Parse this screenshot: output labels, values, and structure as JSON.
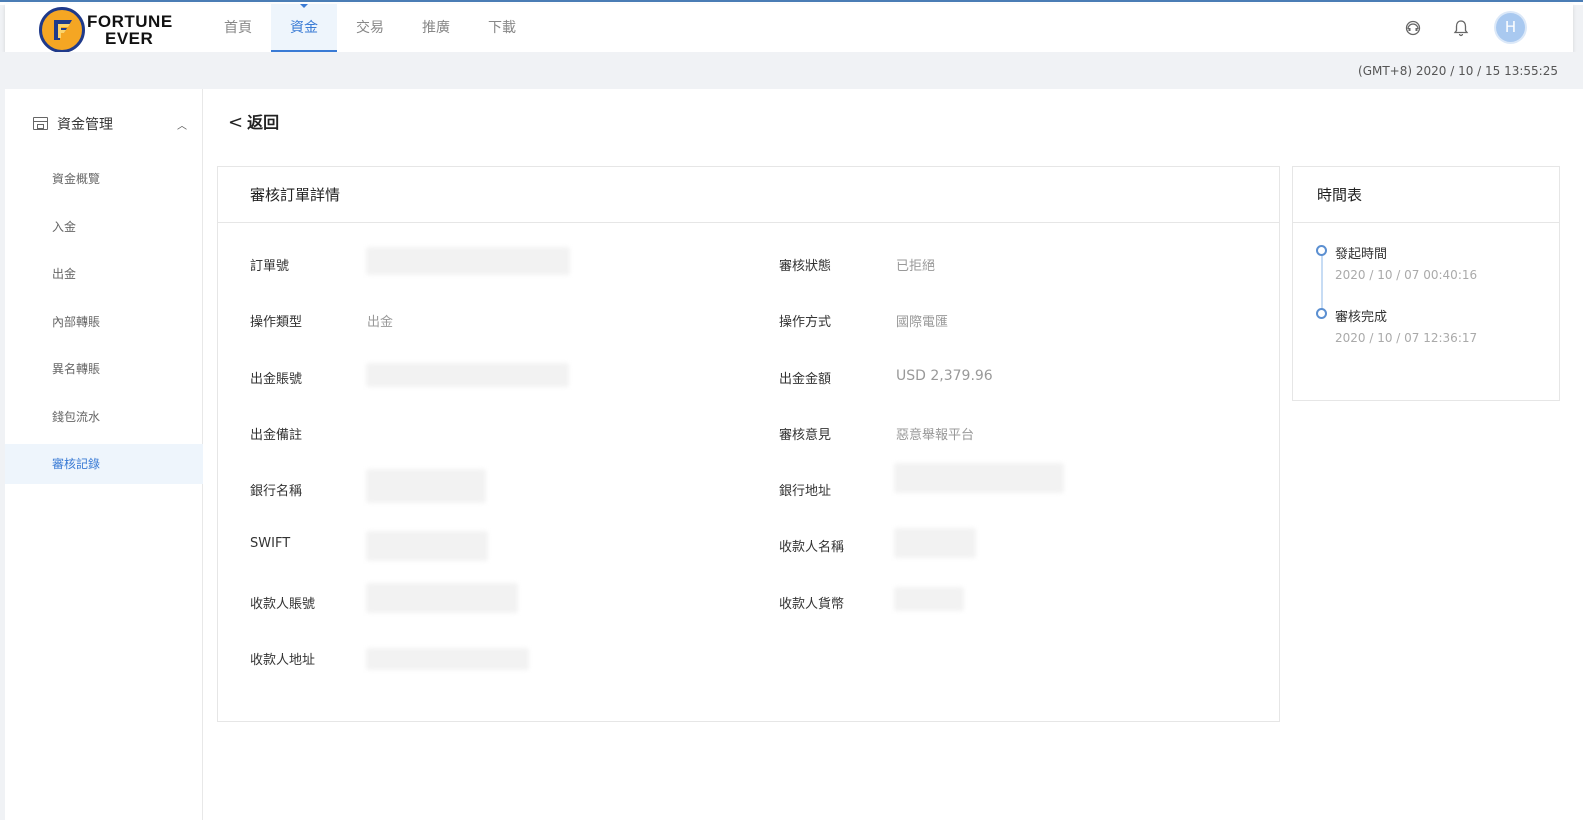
{
  "logo": {
    "line1": "FORTUNE",
    "line2": "EVER"
  },
  "nav": [
    {
      "label": "首頁",
      "active": false
    },
    {
      "label": "資金",
      "active": true
    },
    {
      "label": "交易",
      "active": false
    },
    {
      "label": "推廣",
      "active": false
    },
    {
      "label": "下載",
      "active": false
    }
  ],
  "header": {
    "avatar_initial": "H",
    "icons": [
      "headset-icon",
      "bell-icon"
    ]
  },
  "clock": "(GMT+8) 2020 / 10 / 15 13:55:25",
  "sidebar": {
    "section": "資金管理",
    "items": [
      {
        "label": "資金概覽"
      },
      {
        "label": "入金"
      },
      {
        "label": "出金"
      },
      {
        "label": "內部轉賬"
      },
      {
        "label": "異名轉賬"
      },
      {
        "label": "錢包流水"
      },
      {
        "label": "審核記錄",
        "active": true
      }
    ]
  },
  "back_label": "返回",
  "order": {
    "title": "審核訂單詳情",
    "left": [
      {
        "key": "訂單號",
        "value": ""
      },
      {
        "key": "操作類型",
        "value": "出金"
      },
      {
        "key": "出金賬號",
        "value": ""
      },
      {
        "key": "出金備註",
        "value": ""
      },
      {
        "key": "銀行名稱",
        "value": ""
      },
      {
        "key": "SWIFT",
        "value": ""
      },
      {
        "key": "收款人賬號",
        "value": ""
      },
      {
        "key": "收款人地址",
        "value": ""
      }
    ],
    "right": [
      {
        "key": "審核狀態",
        "value": "已拒絕"
      },
      {
        "key": "操作方式",
        "value": "國際電匯"
      },
      {
        "key": "出金金額",
        "value": "USD 2,379.96"
      },
      {
        "key": "審核意見",
        "value": "惡意舉報平台"
      },
      {
        "key": "銀行地址",
        "value": ""
      },
      {
        "key": "收款人名稱",
        "value": ""
      },
      {
        "key": "收款人貨幣",
        "value": ""
      }
    ]
  },
  "timeline": {
    "title": "時間表",
    "events": [
      {
        "label": "發起時間",
        "time": "2020 / 10 / 07 00:40:16"
      },
      {
        "label": "審核完成",
        "time": "2020 / 10 / 07 12:36:17"
      }
    ]
  },
  "colors": {
    "accent": "#3a7bd5",
    "active_bg": "#eef5fc",
    "muted": "#999999"
  }
}
